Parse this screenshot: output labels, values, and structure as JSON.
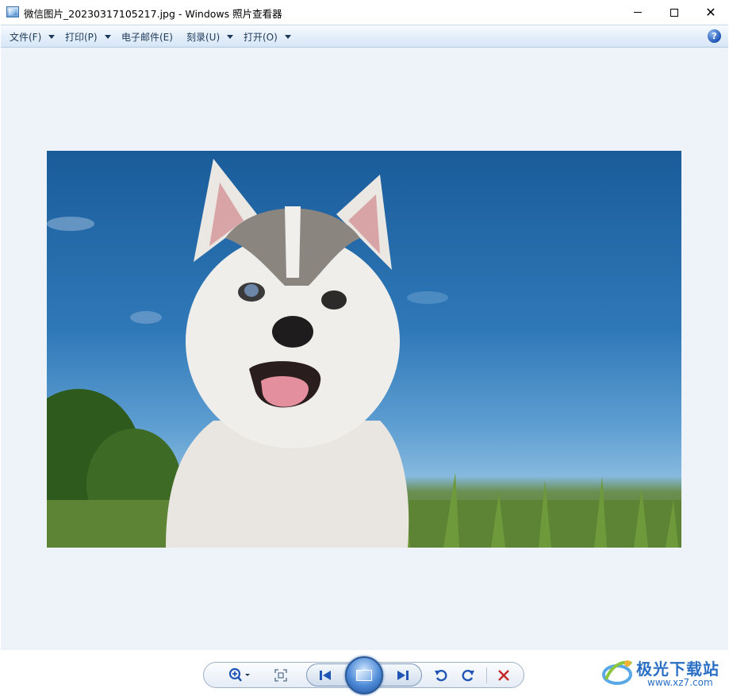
{
  "window": {
    "title": "微信图片_20230317105217.jpg - Windows 照片查看器",
    "controls": {
      "minimize": "minimize-icon",
      "maximize": "maximize-icon",
      "close": "close-icon",
      "close_glyph": "✕"
    }
  },
  "menubar": {
    "items": [
      {
        "label": "文件(F)",
        "has_dropdown": true
      },
      {
        "label": "打印(P)",
        "has_dropdown": true
      },
      {
        "label": "电子邮件(E)",
        "has_dropdown": false
      },
      {
        "label": "刻录(U)",
        "has_dropdown": true
      },
      {
        "label": "打开(O)",
        "has_dropdown": true
      }
    ],
    "help_glyph": "?"
  },
  "viewer": {
    "image_subject": "husky puppy"
  },
  "toolbar": {
    "icons": [
      "zoom-icon",
      "actual-size-icon",
      "previous-icon",
      "slideshow-icon",
      "next-icon",
      "rotate-counterclockwise-icon",
      "rotate-clockwise-icon",
      "delete-icon"
    ]
  },
  "watermark": {
    "title": "极光下载站",
    "url": "www.xz7.com"
  },
  "colors": {
    "viewer_background": "#eef2f9",
    "menubar_text": "#1e3957",
    "accent_blue": "#1f56b5",
    "delete_red": "#c62828"
  }
}
